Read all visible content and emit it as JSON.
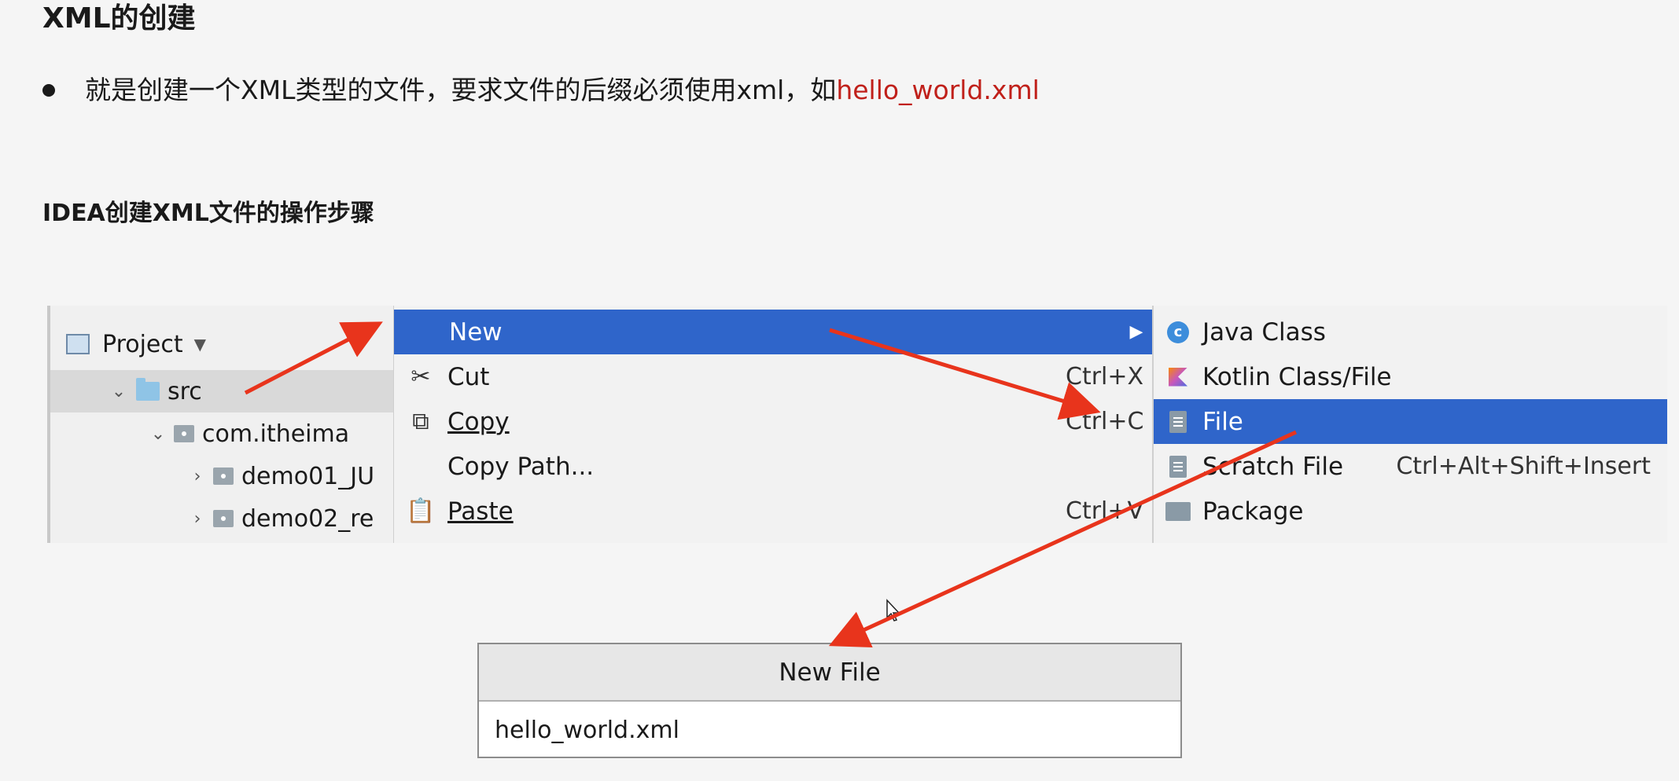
{
  "heading": "XML的创建",
  "bullet": {
    "text": "就是创建一个XML类型的文件，要求文件的后缀必须使用xml，如",
    "highlight": "hello_world.xml"
  },
  "subheading": "IDEA创建XML文件的操作步骤",
  "project_panel": {
    "title": "Project",
    "tree": [
      "src",
      "com.itheima",
      "demo01_JU",
      "demo02_re"
    ]
  },
  "context_menu": {
    "items": [
      {
        "label": "New",
        "shortcut": ""
      },
      {
        "label": "Cut",
        "shortcut": "Ctrl+X",
        "icon": "scissors-icon"
      },
      {
        "label": "Copy",
        "shortcut": "Ctrl+C",
        "icon": "copy-icon"
      },
      {
        "label": "Copy Path...",
        "shortcut": ""
      },
      {
        "label": "Paste",
        "shortcut": "Ctrl+V",
        "icon": "clipboard-icon"
      }
    ]
  },
  "submenu": {
    "items": [
      {
        "label": "Java Class",
        "shortcut": ""
      },
      {
        "label": "Kotlin Class/File",
        "shortcut": ""
      },
      {
        "label": "File",
        "shortcut": ""
      },
      {
        "label": "Scratch File",
        "shortcut": "Ctrl+Alt+Shift+Insert"
      },
      {
        "label": "Package",
        "shortcut": ""
      }
    ]
  },
  "dialog": {
    "title": "New File",
    "value": "hello_world.xml"
  },
  "colors": {
    "highlight": "#2f65ca",
    "red_text": "#c0201a",
    "arrow": "#e8341c"
  }
}
